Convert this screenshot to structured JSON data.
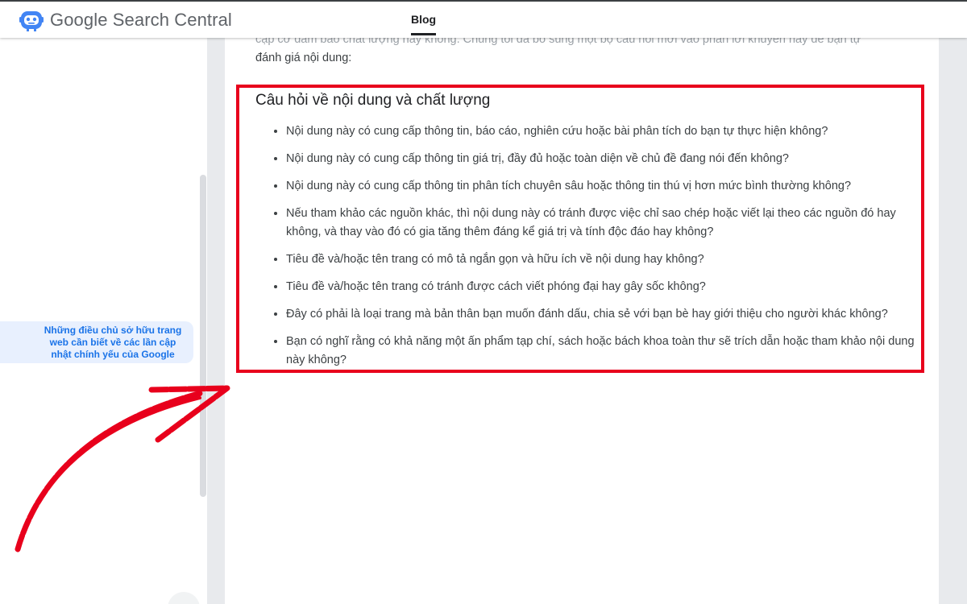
{
  "header": {
    "logo": "search-central-logo-icon",
    "site_title": "Google Search Central",
    "nav_blog": "Blog"
  },
  "sidebar": {
    "active_link": "Những điều chủ sở hữu trang web cần biết về các lần cập nhật chính yếu của Google"
  },
  "content": {
    "intro_faded": "cập cơ đảm bảo chất lượng hay không. Chúng tôi đã bổ sung một bộ câu hỏi mới vào phần lời khuyên hay để bạn tự",
    "intro_line": "đánh giá nội dung:",
    "section_heading": "Câu hỏi về nội dung và chất lượng",
    "questions": [
      "Nội dung này có cung cấp thông tin, báo cáo, nghiên cứu hoặc bài phân tích do bạn tự thực hiện không?",
      "Nội dung này có cung cấp thông tin giá trị, đầy đủ hoặc toàn diện về chủ đề đang nói đến không?",
      "Nội dung này có cung cấp thông tin phân tích chuyên sâu hoặc thông tin thú vị hơn mức bình thường không?",
      "Nếu tham khảo các nguồn khác, thì nội dung này có tránh được việc chỉ sao chép hoặc viết lại theo các nguồn đó hay không, và thay vào đó có gia tăng thêm đáng kể giá trị và tính độc đáo hay không?",
      "Tiêu đề và/hoặc tên trang có mô tả ngắn gọn và hữu ích về nội dung hay không?",
      "Tiêu đề và/hoặc tên trang có tránh được cách viết phóng đại hay gây sốc không?",
      "Đây có phải là loại trang mà bản thân bạn muốn đánh dấu, chia sẻ với bạn bè hay giới thiệu cho người khác không?",
      "Bạn có nghĩ rằng có khả năng một ấn phẩm tạp chí, sách hoặc bách khoa toàn thư sẽ trích dẫn hoặc tham khảo nội dung này không?"
    ]
  },
  "colors": {
    "highlight": "#e8001c",
    "link": "#1a73e8",
    "text": "#3c4043"
  },
  "annotations": {
    "arrow": "red-arrow-icon"
  }
}
